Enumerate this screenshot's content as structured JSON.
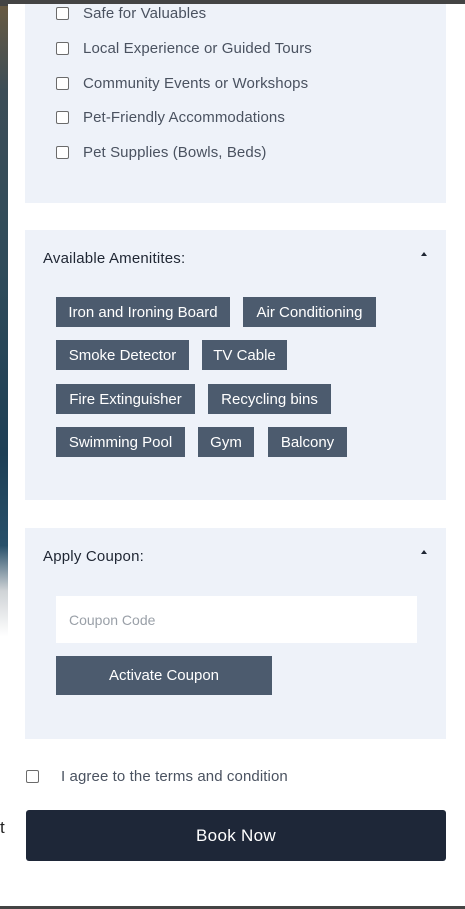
{
  "facilities": {
    "items": [
      {
        "label": "Safe for Valuables",
        "checked": false
      },
      {
        "label": "Local Experience or Guided Tours",
        "checked": false
      },
      {
        "label": "Community Events or Workshops",
        "checked": false
      },
      {
        "label": "Pet-Friendly Accommodations",
        "checked": false
      },
      {
        "label": "Pet Supplies (Bowls, Beds)",
        "checked": false
      }
    ]
  },
  "amenities": {
    "title": "Available Amenitites:",
    "chips": [
      "Iron and Ironing Board",
      "Air Conditioning",
      "Smoke Detector",
      "TV Cable",
      "Fire Extinguisher",
      "Recycling bins",
      "Swimming Pool",
      "Gym",
      "Balcony"
    ]
  },
  "coupon": {
    "title": "Apply Coupon:",
    "placeholder": "Coupon Code",
    "button_label": "Activate Coupon"
  },
  "terms": {
    "label": "I agree to the terms and condition",
    "checked": false
  },
  "book_button_label": "Book Now",
  "background_text": "t",
  "colors": {
    "panel_bg": "#eef2f9",
    "chip_bg": "#4c5b6e",
    "primary_button": "#1e2738",
    "text": "#4a5260"
  }
}
